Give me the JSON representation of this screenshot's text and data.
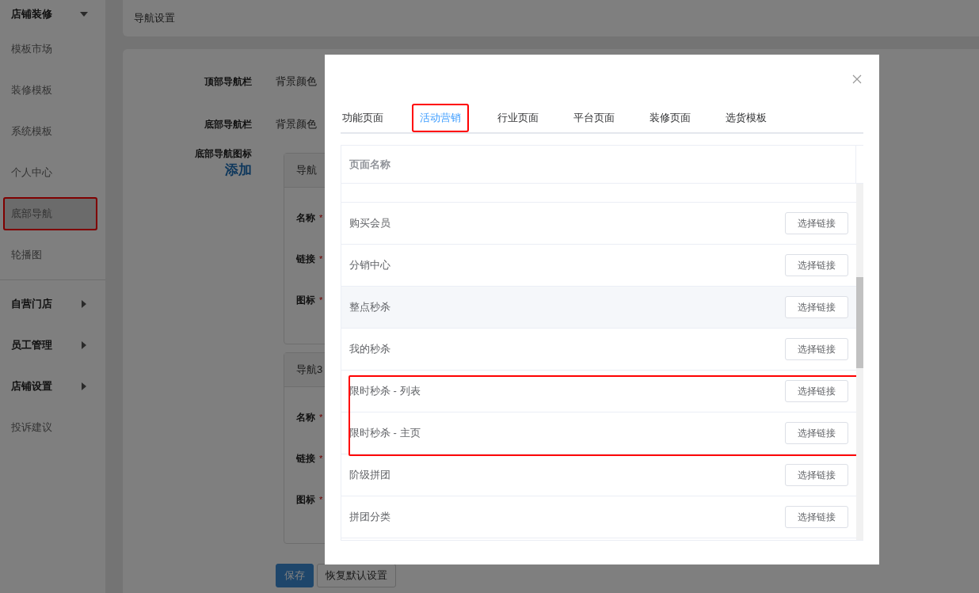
{
  "sidebar": {
    "items": [
      {
        "label": "店铺装修",
        "kind": "group",
        "expanded": true,
        "selected": false,
        "annotated": false
      },
      {
        "label": "模板市场",
        "kind": "item",
        "selected": false,
        "annotated": false
      },
      {
        "label": "装修模板",
        "kind": "item",
        "selected": false,
        "annotated": false
      },
      {
        "label": "系统模板",
        "kind": "item",
        "selected": false,
        "annotated": false
      },
      {
        "label": "个人中心",
        "kind": "item",
        "selected": false,
        "annotated": false
      },
      {
        "label": "底部导航",
        "kind": "item",
        "selected": true,
        "annotated": true
      },
      {
        "label": "轮播图",
        "kind": "item",
        "selected": false,
        "annotated": false
      },
      {
        "label": "自营门店",
        "kind": "group",
        "expanded": false,
        "selected": false,
        "annotated": false
      },
      {
        "label": "员工管理",
        "kind": "group",
        "expanded": false,
        "selected": false,
        "annotated": false
      },
      {
        "label": "店铺设置",
        "kind": "group",
        "expanded": false,
        "selected": false,
        "annotated": false
      },
      {
        "label": "投诉建议",
        "kind": "item",
        "selected": false,
        "annotated": false
      }
    ]
  },
  "page": {
    "title": "导航设置",
    "settings": [
      {
        "label": "顶部导航栏",
        "value": "背景颜色"
      },
      {
        "label": "底部导航栏",
        "value": "背景颜色"
      }
    ],
    "icons_label": "底部导航图标",
    "add_link": "添加",
    "nav_cards": [
      {
        "title": "导航",
        "fields": [
          {
            "label": "名称",
            "mark": "*"
          },
          {
            "label": "链接",
            "mark": "*"
          },
          {
            "label": "图标",
            "mark": "*"
          }
        ]
      },
      {
        "title": "导航3",
        "fields": [
          {
            "label": "名称",
            "mark": "*"
          },
          {
            "label": "链接",
            "mark": "*"
          },
          {
            "label": "图标",
            "mark": "*"
          }
        ]
      }
    ],
    "buttons": [
      {
        "label": "保存",
        "kind": "primary"
      },
      {
        "label": "恢复默认设置",
        "kind": "default"
      }
    ]
  },
  "dialog": {
    "tabs": [
      {
        "label": "功能页面",
        "selected": false,
        "annotated": false
      },
      {
        "label": "活动营销",
        "selected": true,
        "annotated": true
      },
      {
        "label": "行业页面",
        "selected": false,
        "annotated": false
      },
      {
        "label": "平台页面",
        "selected": false,
        "annotated": false
      },
      {
        "label": "装修页面",
        "selected": false,
        "annotated": false
      },
      {
        "label": "选货模板",
        "selected": false,
        "annotated": false
      }
    ],
    "table": {
      "columns": [
        "页面名称"
      ],
      "rows": [
        {
          "name": "购买会员",
          "button": "选择链接",
          "hovered": false,
          "annotated": false
        },
        {
          "name": "分销中心",
          "button": "选择链接",
          "hovered": false,
          "annotated": false
        },
        {
          "name": "整点秒杀",
          "button": "选择链接",
          "hovered": true,
          "annotated": false
        },
        {
          "name": "我的秒杀",
          "button": "选择链接",
          "hovered": false,
          "annotated": false
        },
        {
          "name": "限时秒杀 - 列表",
          "button": "选择链接",
          "hovered": false,
          "annotated": true
        },
        {
          "name": "限时秒杀 - 主页",
          "button": "选择链接",
          "hovered": false,
          "annotated": true
        },
        {
          "name": "阶级拼团",
          "button": "选择链接",
          "hovered": false,
          "annotated": false
        },
        {
          "name": "拼团分类",
          "button": "选择链接",
          "hovered": false,
          "annotated": false
        }
      ]
    }
  }
}
